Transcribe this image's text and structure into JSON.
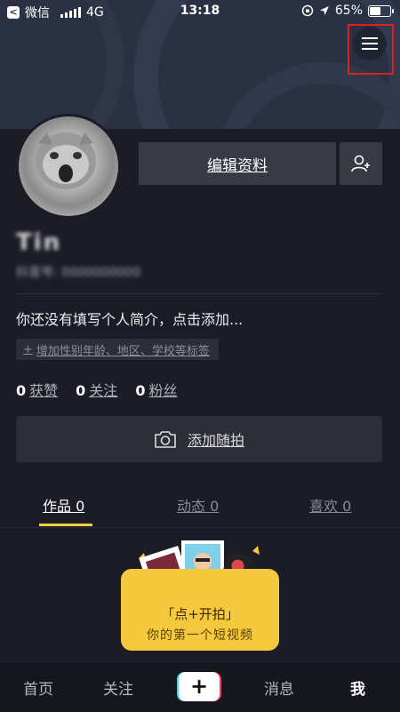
{
  "status_bar": {
    "carrier": "微信",
    "network": "4G",
    "time": "13:18",
    "battery": "65%",
    "battery_level": 0.65
  },
  "header": {
    "menu_icon": "hamburger-menu-icon"
  },
  "profile": {
    "name": "Tin",
    "uid": "抖音号: 0000000000",
    "edit_label": "编辑资料",
    "add_friend_icon": "add-friend-icon",
    "bio": "你还没有填写个人简介，点击添加...",
    "tag_chip": "增加性别年龄、地区、学校等标签",
    "stats": [
      {
        "num": "0",
        "label": "获赞"
      },
      {
        "num": "0",
        "label": "关注"
      },
      {
        "num": "0",
        "label": "粉丝"
      }
    ],
    "add_moment_label": "添加随拍",
    "add_moment_icon": "camera-icon"
  },
  "tabs": [
    {
      "label": "作品 0",
      "active": true
    },
    {
      "label": "动态 0",
      "active": false
    },
    {
      "label": "喜欢 0",
      "active": false
    }
  ],
  "promo": {
    "line1": "「点+开拍」",
    "line2": "你的第一个短视频"
  },
  "bottom_nav": {
    "home": "首页",
    "follow": "关注",
    "plus": "+",
    "messages": "消息",
    "me": "我"
  },
  "colors": {
    "background": "#1b1c26",
    "accent": "#f6cf3f",
    "highlight_border": "#e02020"
  }
}
